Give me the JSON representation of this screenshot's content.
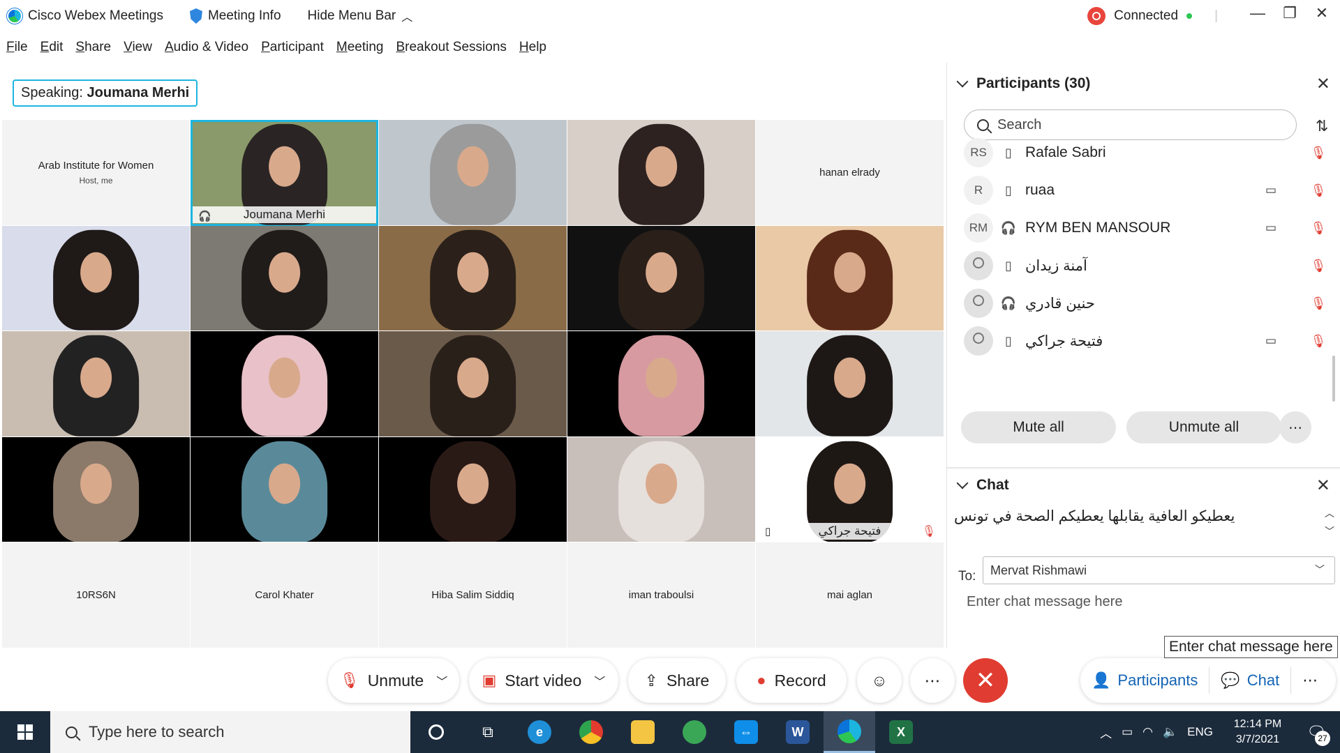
{
  "titlebar": {
    "app_name": "Cisco Webex Meetings",
    "meeting_info": "Meeting Info",
    "hide_menu": "Hide Menu Bar",
    "status": "Connected"
  },
  "menu": [
    "File",
    "Edit",
    "Share",
    "View",
    "Audio & Video",
    "Participant",
    "Meeting",
    "Breakout Sessions",
    "Help"
  ],
  "speaking": {
    "prefix": "Speaking:",
    "name": "Joumana Merhi"
  },
  "tiles": [
    {
      "type": "name",
      "name": "Arab Institute for Women",
      "sub": "Host, me"
    },
    {
      "type": "video",
      "name": "Joumana Merhi",
      "active": true,
      "bg": "#8a9a6a",
      "hair": "#2a2424"
    },
    {
      "type": "video",
      "name": "",
      "bg": "#bfc6cc",
      "hair": "#9b9b9b"
    },
    {
      "type": "video",
      "name": "",
      "bg": "#d8cfc8",
      "hair": "#2d2220"
    },
    {
      "type": "name",
      "name": "hanan elrady",
      "sub": ""
    },
    {
      "type": "video",
      "name": "",
      "bg": "#d9dcea",
      "hair": "#1f1a18"
    },
    {
      "type": "video",
      "name": "",
      "bg": "#7d7a73",
      "hair": "#201c1a"
    },
    {
      "type": "video",
      "name": "",
      "bg": "#8a6b48",
      "hair": "#2b211a"
    },
    {
      "type": "video",
      "name": "",
      "bg": "#111111",
      "hair": "#2a1f19"
    },
    {
      "type": "video",
      "name": "",
      "bg": "#e9c9a6",
      "hair": "#5a2a18"
    },
    {
      "type": "video",
      "name": "",
      "bg": "#c9bdb2",
      "hair": "#222222"
    },
    {
      "type": "video",
      "name": "",
      "bg": "#000000",
      "hair": "#e9c1c8"
    },
    {
      "type": "video",
      "name": "",
      "bg": "#6a5a4a",
      "hair": "#2a201a"
    },
    {
      "type": "video",
      "name": "",
      "bg": "#000000",
      "hair": "#d69aa0"
    },
    {
      "type": "video",
      "name": "",
      "bg": "#e3e6e9",
      "hair": "#1d1816"
    },
    {
      "type": "video",
      "name": "",
      "bg": "#000000",
      "hair": "#8b7a6a"
    },
    {
      "type": "video",
      "name": "",
      "bg": "#000000",
      "hair": "#5a8a9a"
    },
    {
      "type": "video",
      "name": "",
      "bg": "#000000",
      "hair": "#2a1a16"
    },
    {
      "type": "video",
      "name": "",
      "bg": "#c8bfbb",
      "hair": "#e6e0dc"
    },
    {
      "type": "video",
      "name": "فتيحة جراكي",
      "bg": "#ffffff",
      "hair": "#1e1815",
      "phone": true,
      "muted": true
    },
    {
      "type": "name",
      "name": "10RS6N",
      "sub": ""
    },
    {
      "type": "name",
      "name": "Carol Khater",
      "sub": ""
    },
    {
      "type": "name",
      "name": "Hiba Salim Siddiq",
      "sub": ""
    },
    {
      "type": "name",
      "name": "iman traboulsi",
      "sub": ""
    },
    {
      "type": "name",
      "name": "mai aglan",
      "sub": ""
    }
  ],
  "participants_panel": {
    "title": "Participants (30)",
    "search_placeholder": "Search",
    "rows": [
      {
        "initials": "RS",
        "name": "Rafale Sabri",
        "device": "phone",
        "video": false
      },
      {
        "initials": "R",
        "name": "ruaa",
        "device": "phone",
        "video": true
      },
      {
        "initials": "RM",
        "name": "RYM BEN MANSOUR",
        "device": "headset",
        "video": true
      },
      {
        "initials": "",
        "name": "آمنة زيدان",
        "device": "phone",
        "video": false
      },
      {
        "initials": "",
        "name": "حنين قادري",
        "device": "headset",
        "video": false
      },
      {
        "initials": "",
        "name": "فتيحة جراكي",
        "device": "phone",
        "video": true
      }
    ],
    "mute_all": "Mute all",
    "unmute_all": "Unmute all"
  },
  "chat_panel": {
    "title": "Chat",
    "message": "يعطيكو العافية يقابلها يعطيكم الصحة في تونس",
    "to_label": "To:",
    "to_value": "Mervat Rishmawi",
    "input_placeholder": "Enter chat message here",
    "tooltip": "Enter chat message here"
  },
  "controls": {
    "unmute": "Unmute",
    "start_video": "Start video",
    "share": "Share",
    "record": "Record",
    "participants": "Participants",
    "chat": "Chat"
  },
  "taskbar": {
    "search_placeholder": "Type here to search",
    "lang": "ENG",
    "time": "12:14 PM",
    "date": "3/7/2021",
    "notifications": "27"
  },
  "colors": {
    "accent": "#1cb5e0",
    "end_red": "#e03c31",
    "link_blue": "#1464b4",
    "taskbar": "#1c2b3c"
  }
}
